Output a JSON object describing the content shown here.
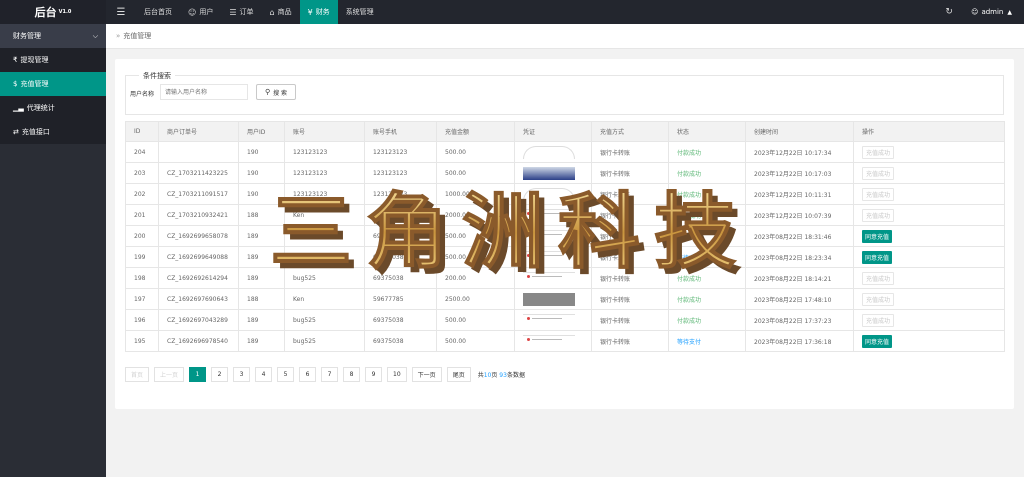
{
  "header": {
    "logo": "后台",
    "version": "V1.0",
    "nav": [
      {
        "label": "后台首页",
        "icon": ""
      },
      {
        "label": "用户",
        "icon": "user-icon"
      },
      {
        "label": "订单",
        "icon": "document-icon"
      },
      {
        "label": "商品",
        "icon": "cart-icon"
      },
      {
        "label": "财务",
        "icon": "yen-icon"
      },
      {
        "label": "系统管理",
        "icon": ""
      }
    ],
    "user": "admin"
  },
  "sidebar": {
    "group": "财务管理",
    "items": [
      {
        "label": "提现管理",
        "icon": "yen-icon"
      },
      {
        "label": "充值管理",
        "icon": "dollar-icon"
      },
      {
        "label": "代理统计",
        "icon": "chart-icon"
      },
      {
        "label": "充值接口",
        "icon": "exchange-icon"
      }
    ]
  },
  "breadcrumb": {
    "current": "充值管理"
  },
  "search": {
    "legend": "条件搜索",
    "label": "用户名称",
    "placeholder": "请输入用户名称",
    "button": "搜 索"
  },
  "table": {
    "headers": [
      "ID",
      "商户订单号",
      "用户ID",
      "账号",
      "账号手机",
      "充值金额",
      "凭证",
      "充值方式",
      "状态",
      "创建时间",
      "操作"
    ],
    "rows": [
      {
        "id": "204",
        "order": "",
        "uid": "190",
        "account": "123123123",
        "phone": "123123123",
        "amount": "500.00",
        "voucher": "arc",
        "method": "银行卡转账",
        "status": "付款成功",
        "status_type": "ok",
        "created": "2023年12月22日 10:17:34",
        "action": "充值成功",
        "action_type": "disabled"
      },
      {
        "id": "203",
        "order": "CZ_1703211423225",
        "uid": "190",
        "account": "123123123",
        "phone": "123123123",
        "amount": "500.00",
        "voucher": "blue",
        "method": "银行卡转账",
        "status": "付款成功",
        "status_type": "ok",
        "created": "2023年12月22日 10:17:03",
        "action": "充值成功",
        "action_type": "disabled"
      },
      {
        "id": "202",
        "order": "CZ_1703211091517",
        "uid": "190",
        "account": "123123123",
        "phone": "123123123",
        "amount": "1000.00",
        "voucher": "arc",
        "method": "银行卡转账",
        "status": "付款成功",
        "status_type": "ok",
        "created": "2023年12月22日 10:11:31",
        "action": "充值成功",
        "action_type": "disabled"
      },
      {
        "id": "201",
        "order": "CZ_1703210932421",
        "uid": "188",
        "account": "Ken",
        "phone": "59677785",
        "amount": "2000.00",
        "voucher": "receipt",
        "method": "银行卡转账",
        "status": "付款成功",
        "status_type": "ok",
        "created": "2023年12月22日 10:07:39",
        "action": "充值成功",
        "action_type": "disabled"
      },
      {
        "id": "200",
        "order": "CZ_1692699658078",
        "uid": "189",
        "account": "bug525",
        "phone": "69375038",
        "amount": "500.00",
        "voucher": "receipt",
        "method": "银行卡转账",
        "status": "等待支付",
        "status_type": "wait",
        "created": "2023年08月22日 18:31:46",
        "action": "同意充值",
        "action_type": "agree"
      },
      {
        "id": "199",
        "order": "CZ_1692699649088",
        "uid": "189",
        "account": "bug525",
        "phone": "69375038",
        "amount": "500.00",
        "voucher": "receipt",
        "method": "银行卡转账",
        "status": "等待支付",
        "status_type": "wait",
        "created": "2023年08月22日 18:23:34",
        "action": "同意充值",
        "action_type": "agree"
      },
      {
        "id": "198",
        "order": "CZ_1692692614294",
        "uid": "189",
        "account": "bug525",
        "phone": "69375038",
        "amount": "200.00",
        "voucher": "receipt",
        "method": "银行卡转账",
        "status": "付款成功",
        "status_type": "ok",
        "created": "2023年08月22日 18:14:21",
        "action": "充值成功",
        "action_type": "disabled"
      },
      {
        "id": "197",
        "order": "CZ_1692697690643",
        "uid": "188",
        "account": "Ken",
        "phone": "59677785",
        "amount": "2500.00",
        "voucher": "gray",
        "method": "银行卡转账",
        "status": "付款成功",
        "status_type": "ok",
        "created": "2023年08月22日 17:48:10",
        "action": "充值成功",
        "action_type": "disabled"
      },
      {
        "id": "196",
        "order": "CZ_1692697043289",
        "uid": "189",
        "account": "bug525",
        "phone": "69375038",
        "amount": "500.00",
        "voucher": "receipt",
        "method": "银行卡转账",
        "status": "付款成功",
        "status_type": "ok",
        "created": "2023年08月22日 17:37:23",
        "action": "充值成功",
        "action_type": "disabled"
      },
      {
        "id": "195",
        "order": "CZ_1692696978540",
        "uid": "189",
        "account": "bug525",
        "phone": "69375038",
        "amount": "500.00",
        "voucher": "receipt",
        "method": "银行卡转账",
        "status": "等待支付",
        "status_type": "wait",
        "created": "2023年08月22日 17:36:18",
        "action": "同意充值",
        "action_type": "agree"
      }
    ]
  },
  "pager": {
    "first": "首页",
    "prev": "上一页",
    "pages": [
      "1",
      "2",
      "3",
      "4",
      "5",
      "6",
      "7",
      "8",
      "9",
      "10"
    ],
    "current": "1",
    "next": "下一页",
    "last": "尾页",
    "info_prefix": "共",
    "total_pages": "10",
    "info_mid": "页",
    "total_items": "93",
    "info_suffix": "条数据"
  },
  "watermark": {
    "text": "三角洲科技"
  },
  "colors": {
    "accent": "#009688",
    "header": "#23262e",
    "sidebar": "#2a2d35",
    "success": "#5fb878",
    "pending": "#1e9fff"
  }
}
